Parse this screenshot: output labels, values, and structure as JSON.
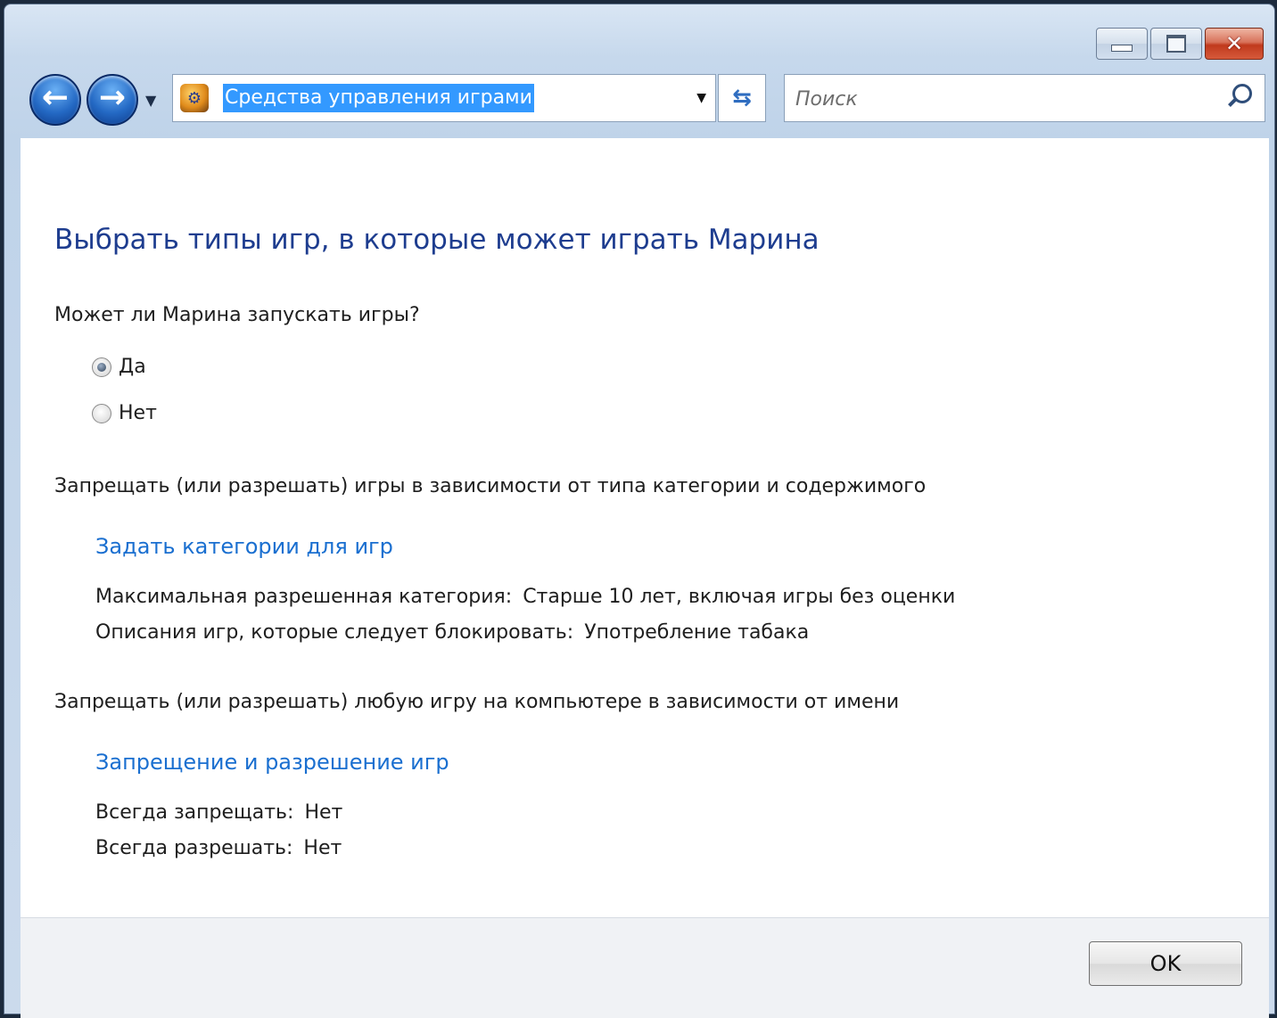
{
  "window": {
    "caption_buttons": {
      "minimize": "minimize-icon",
      "maximize": "maximize-icon",
      "close": "✕"
    }
  },
  "nav": {
    "back_icon": "back-arrow-icon",
    "forward_icon": "forward-arrow-icon",
    "address": "Средства управления играми",
    "search_placeholder": "Поиск"
  },
  "main": {
    "heading": "Выбрать типы игр, в которые может играть Марина",
    "question": "Может ли Марина запускать игры?",
    "options": [
      {
        "label": "Да",
        "checked": true
      },
      {
        "label": "Нет",
        "checked": false
      }
    ],
    "section1": {
      "title": "Запрещать (или разрешать) игры в зависимости от типа категории и содержимого",
      "link": "Задать категории для игр",
      "rows": [
        {
          "label": "Максимальная разрешенная категория:",
          "value": "Старше 10 лет, включая игры без оценки"
        },
        {
          "label": "Описания игр, которые следует блокировать:",
          "value": "Употребление табака"
        }
      ]
    },
    "section2": {
      "title": "Запрещать (или разрешать) любую игру на компьютере в зависимости от имени",
      "link": "Запрещение и разрешение игр",
      "rows": [
        {
          "label": "Всегда запрещать:",
          "value": "Нет"
        },
        {
          "label": "Всегда разрешать:",
          "value": "Нет"
        }
      ]
    }
  },
  "footer": {
    "ok_label": "OK"
  }
}
